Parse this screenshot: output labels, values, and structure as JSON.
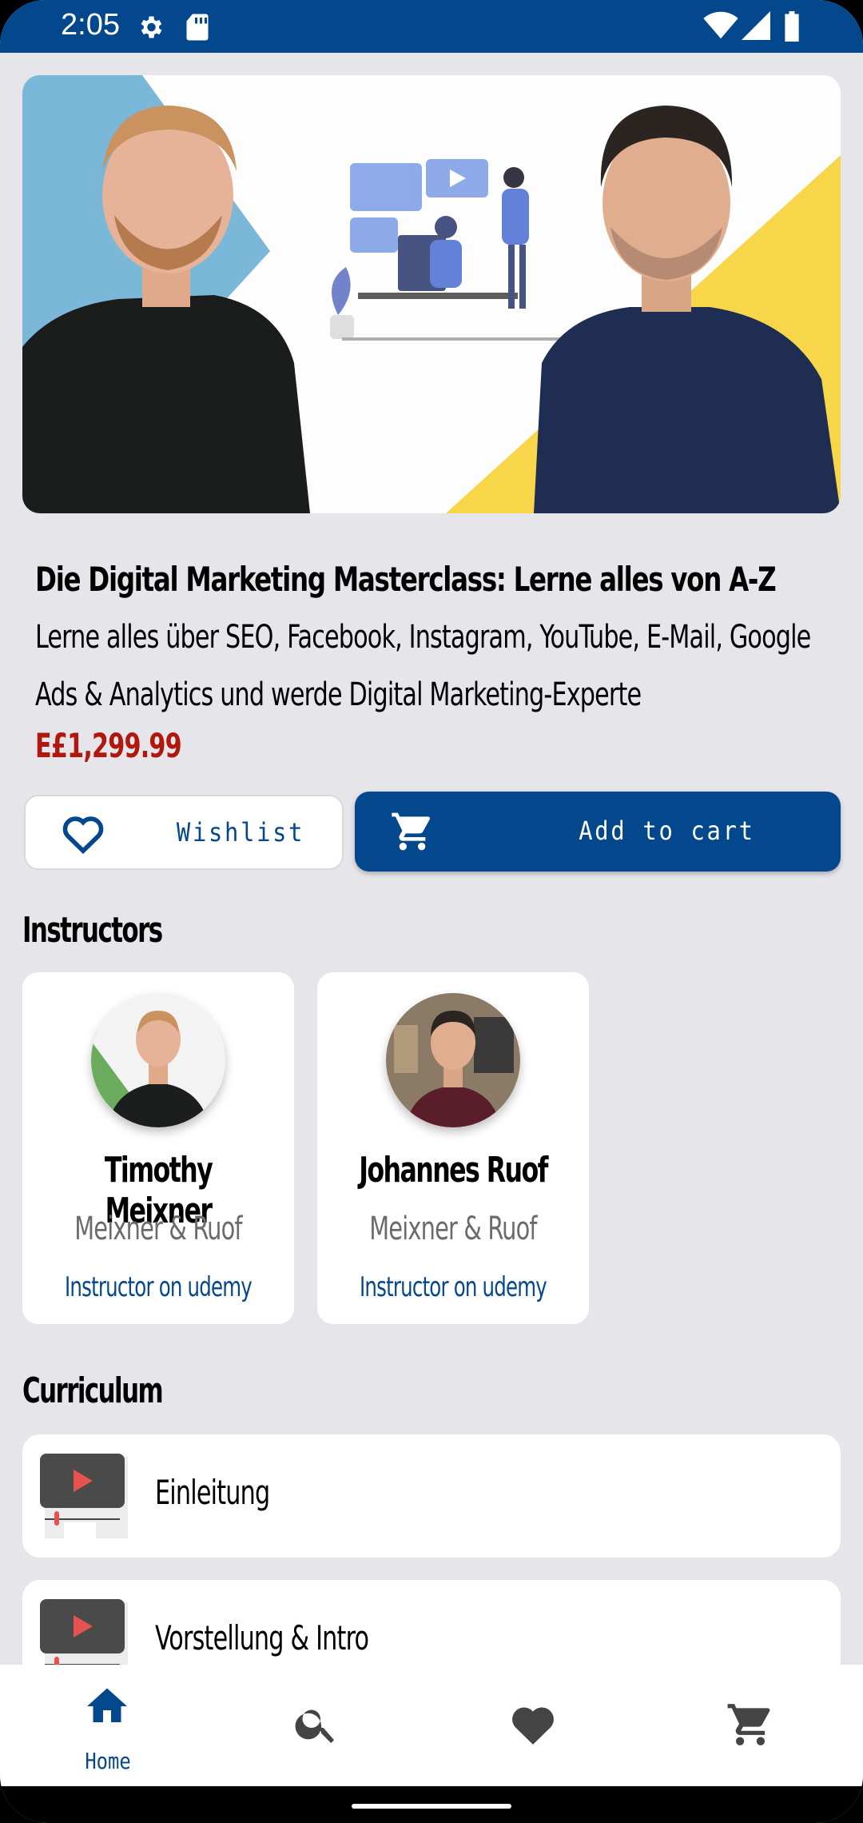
{
  "status_bar": {
    "time": "2:05",
    "icons": [
      "settings-icon",
      "sd-card-icon",
      "wifi-icon",
      "signal-icon",
      "battery-icon"
    ]
  },
  "course": {
    "title": "Die Digital Marketing Masterclass: Lerne alles von A-Z",
    "subtitle_line1": "Lerne alles über SEO, Facebook, Instagram, YouTube, E-Mail, Google",
    "subtitle_line2": "Ads & Analytics und werde Digital Marketing-Experte",
    "price": "E£1,299.99"
  },
  "actions": {
    "wishlist_label": "Wishlist",
    "add_to_cart_label": "Add to cart"
  },
  "instructors": {
    "heading": "Instructors",
    "items": [
      {
        "name": "Timothy Meixner",
        "company": "Meixner & Ruof",
        "role": "Instructor on udemy"
      },
      {
        "name": "Johannes Ruof",
        "company": "Meixner & Ruof",
        "role": "Instructor on udemy"
      }
    ]
  },
  "curriculum": {
    "heading": "Curriculum",
    "lessons": [
      {
        "title": "Einleitung"
      },
      {
        "title": "Vorstellung & Intro"
      }
    ]
  },
  "bottom_nav": {
    "items": [
      {
        "icon": "home-icon",
        "label": "Home",
        "active": true
      },
      {
        "icon": "search-icon",
        "label": ""
      },
      {
        "icon": "heart-icon",
        "label": ""
      },
      {
        "icon": "cart-icon",
        "label": ""
      }
    ]
  },
  "colors": {
    "primary": "#03478d",
    "price": "#b0170d",
    "background": "#e6e5e9"
  }
}
